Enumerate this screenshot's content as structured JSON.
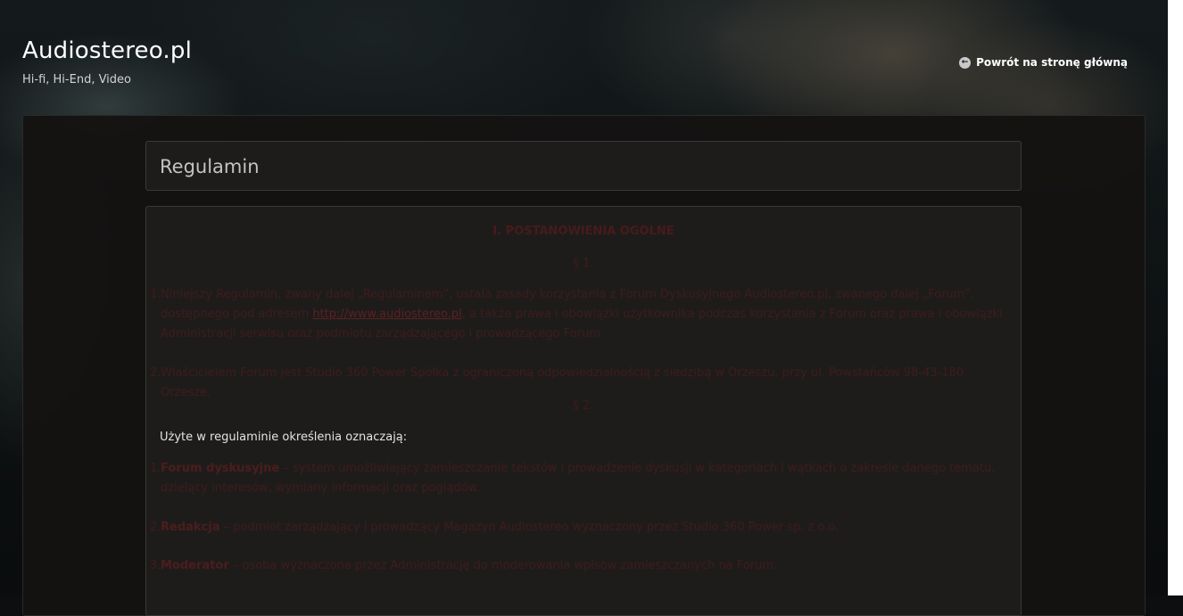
{
  "header": {
    "site_title": "Audiostereo.pl",
    "tagline": "Hi-fi, Hi-End, Video",
    "back_link": "Powrót na stronę główną",
    "back_icon": "arrow-left-circle-icon"
  },
  "page": {
    "title": "Regulamin"
  },
  "content": {
    "section_heading": "I. POSTANOWIENIA OGÓLNE",
    "para1": "§ 1.",
    "item1_num": "1.",
    "item1_text_a": "Niniejszy Regulamin, zwany dalej „Regulaminem”, ustala zasady korzystania z Forum Dyskusyjnego Audiostereo.pl, zwanego dalej „Forum”, dostępnego pod adresem ",
    "item1_link": "http://www.audiostereo.pl",
    "item1_text_b": ", a także prawa i obowiązki użytkownika podczas korzystania z Forum oraz prawa i obowiązki Administracji serwisu oraz podmiotu zarządzającego i prowadzącego Forum.",
    "item2_num": "2.",
    "item2_text": "Właścicielem Forum jest Studio 360 Power Spółka z ograniczoną odpowiedzialnością z siedzibą w Orzeszu, przy ul. Powstańców 98-43-180 Orzesze.",
    "para2": "§ 2.",
    "defs_intro": "Użyte w regulaminie określenia oznaczają:",
    "item3_num": "1.",
    "item3_term": "Forum dyskusyjne",
    "item3_text": " – system umożliwiający zamieszczanie tekstów i prowadzenie dyskusji w kategoriach i wątkach o zakresie danego tematu, dzielący interesów, wymiany informacji oraz poglądów.",
    "item4_num": "2.",
    "item4_term": "Redakcja",
    "item4_text": " – podmiot zarządzający i prowadzący Magazyn Audiostereo wyznaczony przez Studio 360 Power sp. z o.o.",
    "item5_num": "3.",
    "item5_term": "Moderator",
    "item5_text": " – osoba wyznaczona przez Administrację do moderowania wpisów zamieszczanych na Forum."
  },
  "colors": {
    "page_background": "#0c0e0f",
    "panel_background": "#151312",
    "box_background": "#1e1c1b",
    "box_border": "#3b3937",
    "title_text": "#ffffff",
    "content_text": "#3e1c1c",
    "definition_intro_text": "#e3e3e3"
  }
}
